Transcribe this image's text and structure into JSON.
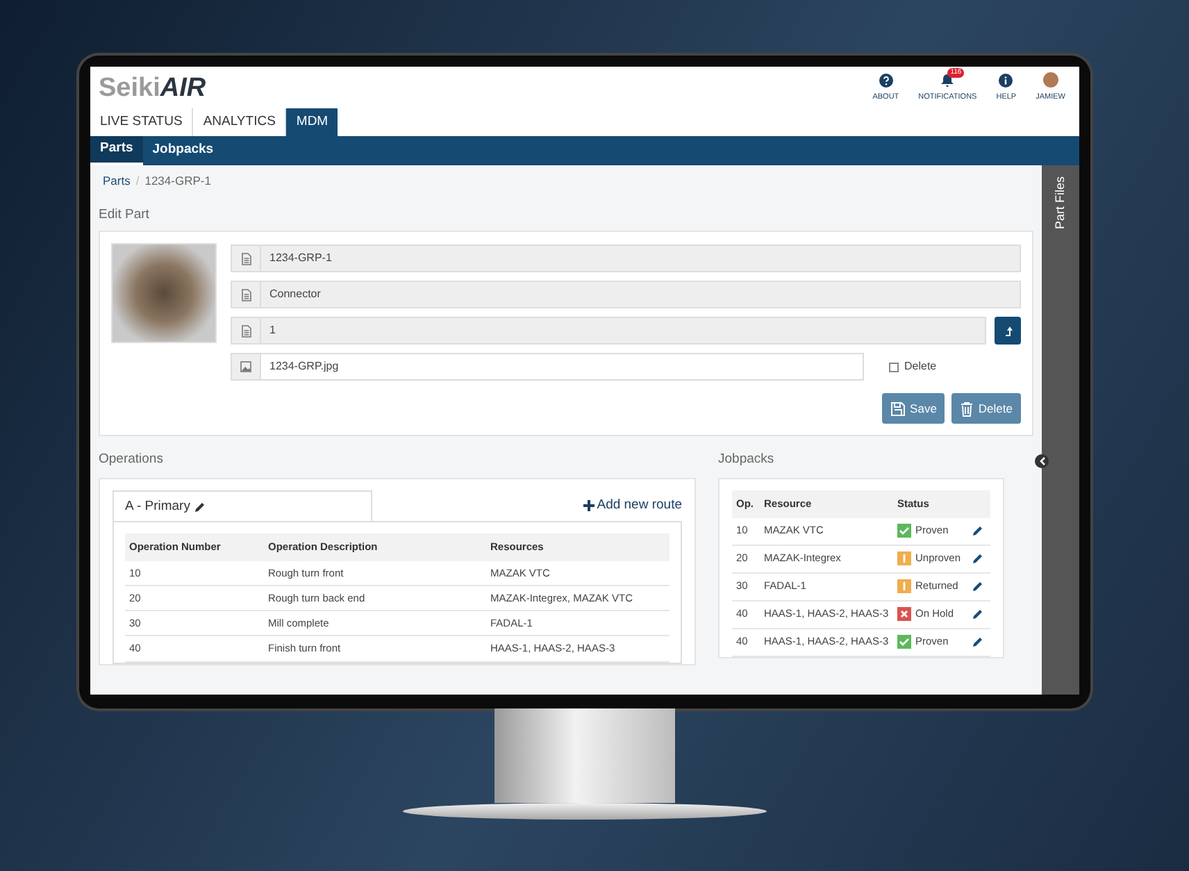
{
  "app": {
    "logo_light": "Seiki",
    "logo_bold": "AIR"
  },
  "header_actions": [
    {
      "kind": "about",
      "label": "ABOUT"
    },
    {
      "kind": "notifications",
      "label": "NOTIFICATIONS",
      "badge": "116"
    },
    {
      "kind": "help",
      "label": "HELP"
    },
    {
      "kind": "user",
      "label": "JAMIEW"
    }
  ],
  "tabs": [
    {
      "label": "LIVE STATUS",
      "selected": false
    },
    {
      "label": "ANALYTICS",
      "selected": false
    },
    {
      "label": "MDM",
      "selected": true
    }
  ],
  "subnav": [
    {
      "label": "Parts",
      "selected": true
    },
    {
      "label": "Jobpacks",
      "selected": false
    }
  ],
  "breadcrumb": {
    "items": [
      "Parts",
      "1234-GRP-1"
    ],
    "separator": "/"
  },
  "side_panel": {
    "title": "Part Files"
  },
  "edit_part": {
    "title": "Edit Part",
    "fields": [
      {
        "kind": "readonly",
        "value": "1234-GRP-1"
      },
      {
        "kind": "readonly",
        "value": "Connector"
      },
      {
        "kind": "readonly_action",
        "value": "1"
      },
      {
        "kind": "file",
        "value": "1234-GRP.jpg"
      }
    ],
    "delete_checkbox": {
      "label": "Delete",
      "checked": false
    },
    "buttons": [
      {
        "kind": "save",
        "label": "Save"
      },
      {
        "kind": "delete",
        "label": "Delete"
      }
    ]
  },
  "operations": {
    "title": "Operations",
    "routes": [
      {
        "label": "A - Primary",
        "selected": true
      }
    ],
    "add_route": "Add new route",
    "columns": [
      "Operation Number",
      "Operation Description",
      "Resources"
    ],
    "rows": [
      [
        "10",
        "Rough turn front",
        "MAZAK VTC"
      ],
      [
        "20",
        "Rough turn back end",
        "MAZAK-Integrex, MAZAK VTC"
      ],
      [
        "30",
        "Mill complete",
        "FADAL-1"
      ],
      [
        "40",
        "Finish turn front",
        "HAAS-1, HAAS-2, HAAS-3"
      ]
    ]
  },
  "jobpacks": {
    "title": "Jobpacks",
    "columns": [
      "Op.",
      "Resource",
      "Status"
    ],
    "rows": [
      {
        "op": "10",
        "resource": "MAZAK VTC",
        "status": "Proven",
        "kind": "ok",
        "color": "#5cb85c"
      },
      {
        "op": "20",
        "resource": "MAZAK-Integrex",
        "status": "Unproven",
        "kind": "warning",
        "color": "#f0ad4e"
      },
      {
        "op": "30",
        "resource": "FADAL-1",
        "status": "Returned",
        "kind": "warning",
        "color": "#f0ad4e"
      },
      {
        "op": "40",
        "resource": "HAAS-1, HAAS-2, HAAS-3",
        "status": "On Hold",
        "kind": "error",
        "color": "#d9534f"
      },
      {
        "op": "40",
        "resource": "HAAS-1, HAAS-2, HAAS-3",
        "status": "Proven",
        "kind": "ok",
        "color": "#5cb85c"
      }
    ]
  }
}
